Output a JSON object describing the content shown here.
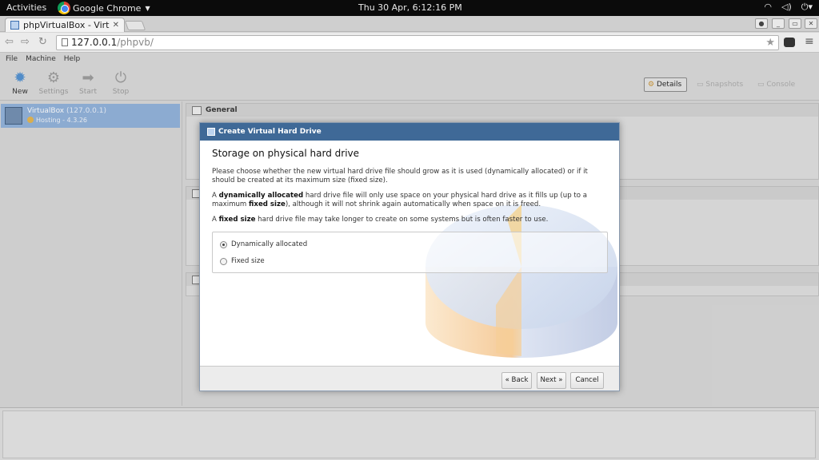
{
  "topbar": {
    "activities": "Activities",
    "app_name": "Google Chrome",
    "clock": "Thu 30 Apr,  6:12:16 PM",
    "tray_icons": [
      "wifi-icon",
      "volume-icon",
      "power-icon"
    ]
  },
  "browser": {
    "tab_title": "phpVirtualBox - Virtu",
    "url_host": "127.0.0.1",
    "url_path": "/phpvb/"
  },
  "app": {
    "menu": [
      "File",
      "Machine",
      "Help"
    ],
    "toolbar": {
      "new": "New",
      "settings": "Settings",
      "start": "Start",
      "stop": "Stop"
    },
    "views": {
      "details": "Details",
      "snapshots": "Snapshots",
      "console": "Console"
    },
    "vm": {
      "name": "VirtualBox",
      "host": "(127.0.0.1)",
      "state": "Hosting - 4.3.26"
    },
    "panels": {
      "general": "General"
    }
  },
  "dialog": {
    "title": "Create Virtual Hard Drive",
    "heading": "Storage on physical hard drive",
    "p1": "Please choose whether the new virtual hard drive file should grow as it is used (dynamically allocated) or if it should be created at its maximum size (fixed size).",
    "p2_prefix": "A ",
    "p2_bold1": "dynamically allocated",
    "p2_mid": " hard drive file will only use space on your physical hard drive as it fills up (up to a maximum ",
    "p2_bold2": "fixed size",
    "p2_suffix": "), although it will not shrink again automatically when space on it is freed.",
    "p3_prefix": "A ",
    "p3_bold": "fixed size",
    "p3_suffix": " hard drive file may take longer to create on some systems but is often faster to use.",
    "options": [
      "Dynamically allocated",
      "Fixed size"
    ],
    "selected_option": "Dynamically allocated",
    "buttons": {
      "back": "« Back",
      "next": "Next »",
      "cancel": "Cancel"
    }
  },
  "colors": {
    "dialog_titlebar": "#3f6997",
    "vm_selected": "#8fb0d9",
    "topbar": "#0b0b0b"
  }
}
